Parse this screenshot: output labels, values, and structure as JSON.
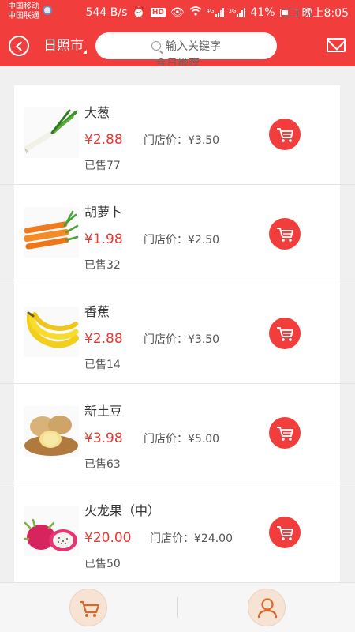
{
  "status_bar": {
    "carrier_1": "中国移动",
    "carrier_2": "中国联通",
    "speed": "544 B/s",
    "hd": "HD",
    "net_1": "4G",
    "net_2": "3G",
    "battery": "41%",
    "time": "晚上8:05"
  },
  "header": {
    "city": "日照市",
    "search_placeholder": "输入关键字"
  },
  "section": {
    "title": "今日推荐"
  },
  "store_price_label": "门店价：",
  "sold_prefix": "已售",
  "products": [
    {
      "name": "大葱",
      "price": "¥2.88",
      "store_price": "¥3.50",
      "sold": "77",
      "image": "green-onion"
    },
    {
      "name": "胡萝卜",
      "price": "¥1.98",
      "store_price": "¥2.50",
      "sold": "32",
      "image": "carrot"
    },
    {
      "name": "香蕉",
      "price": "¥2.88",
      "store_price": "¥3.50",
      "sold": "14",
      "image": "banana"
    },
    {
      "name": "新土豆",
      "price": "¥3.98",
      "store_price": "¥5.00",
      "sold": "63",
      "image": "potato"
    },
    {
      "name": "火龙果（中）",
      "price": "¥20.00",
      "store_price": "¥24.00",
      "sold": "50",
      "image": "dragon-fruit"
    }
  ],
  "colors": {
    "brand": "#f23d3d",
    "price": "#e53935"
  },
  "icons": [
    "back-icon",
    "search-icon",
    "mail-icon",
    "cart-icon",
    "user-icon"
  ]
}
